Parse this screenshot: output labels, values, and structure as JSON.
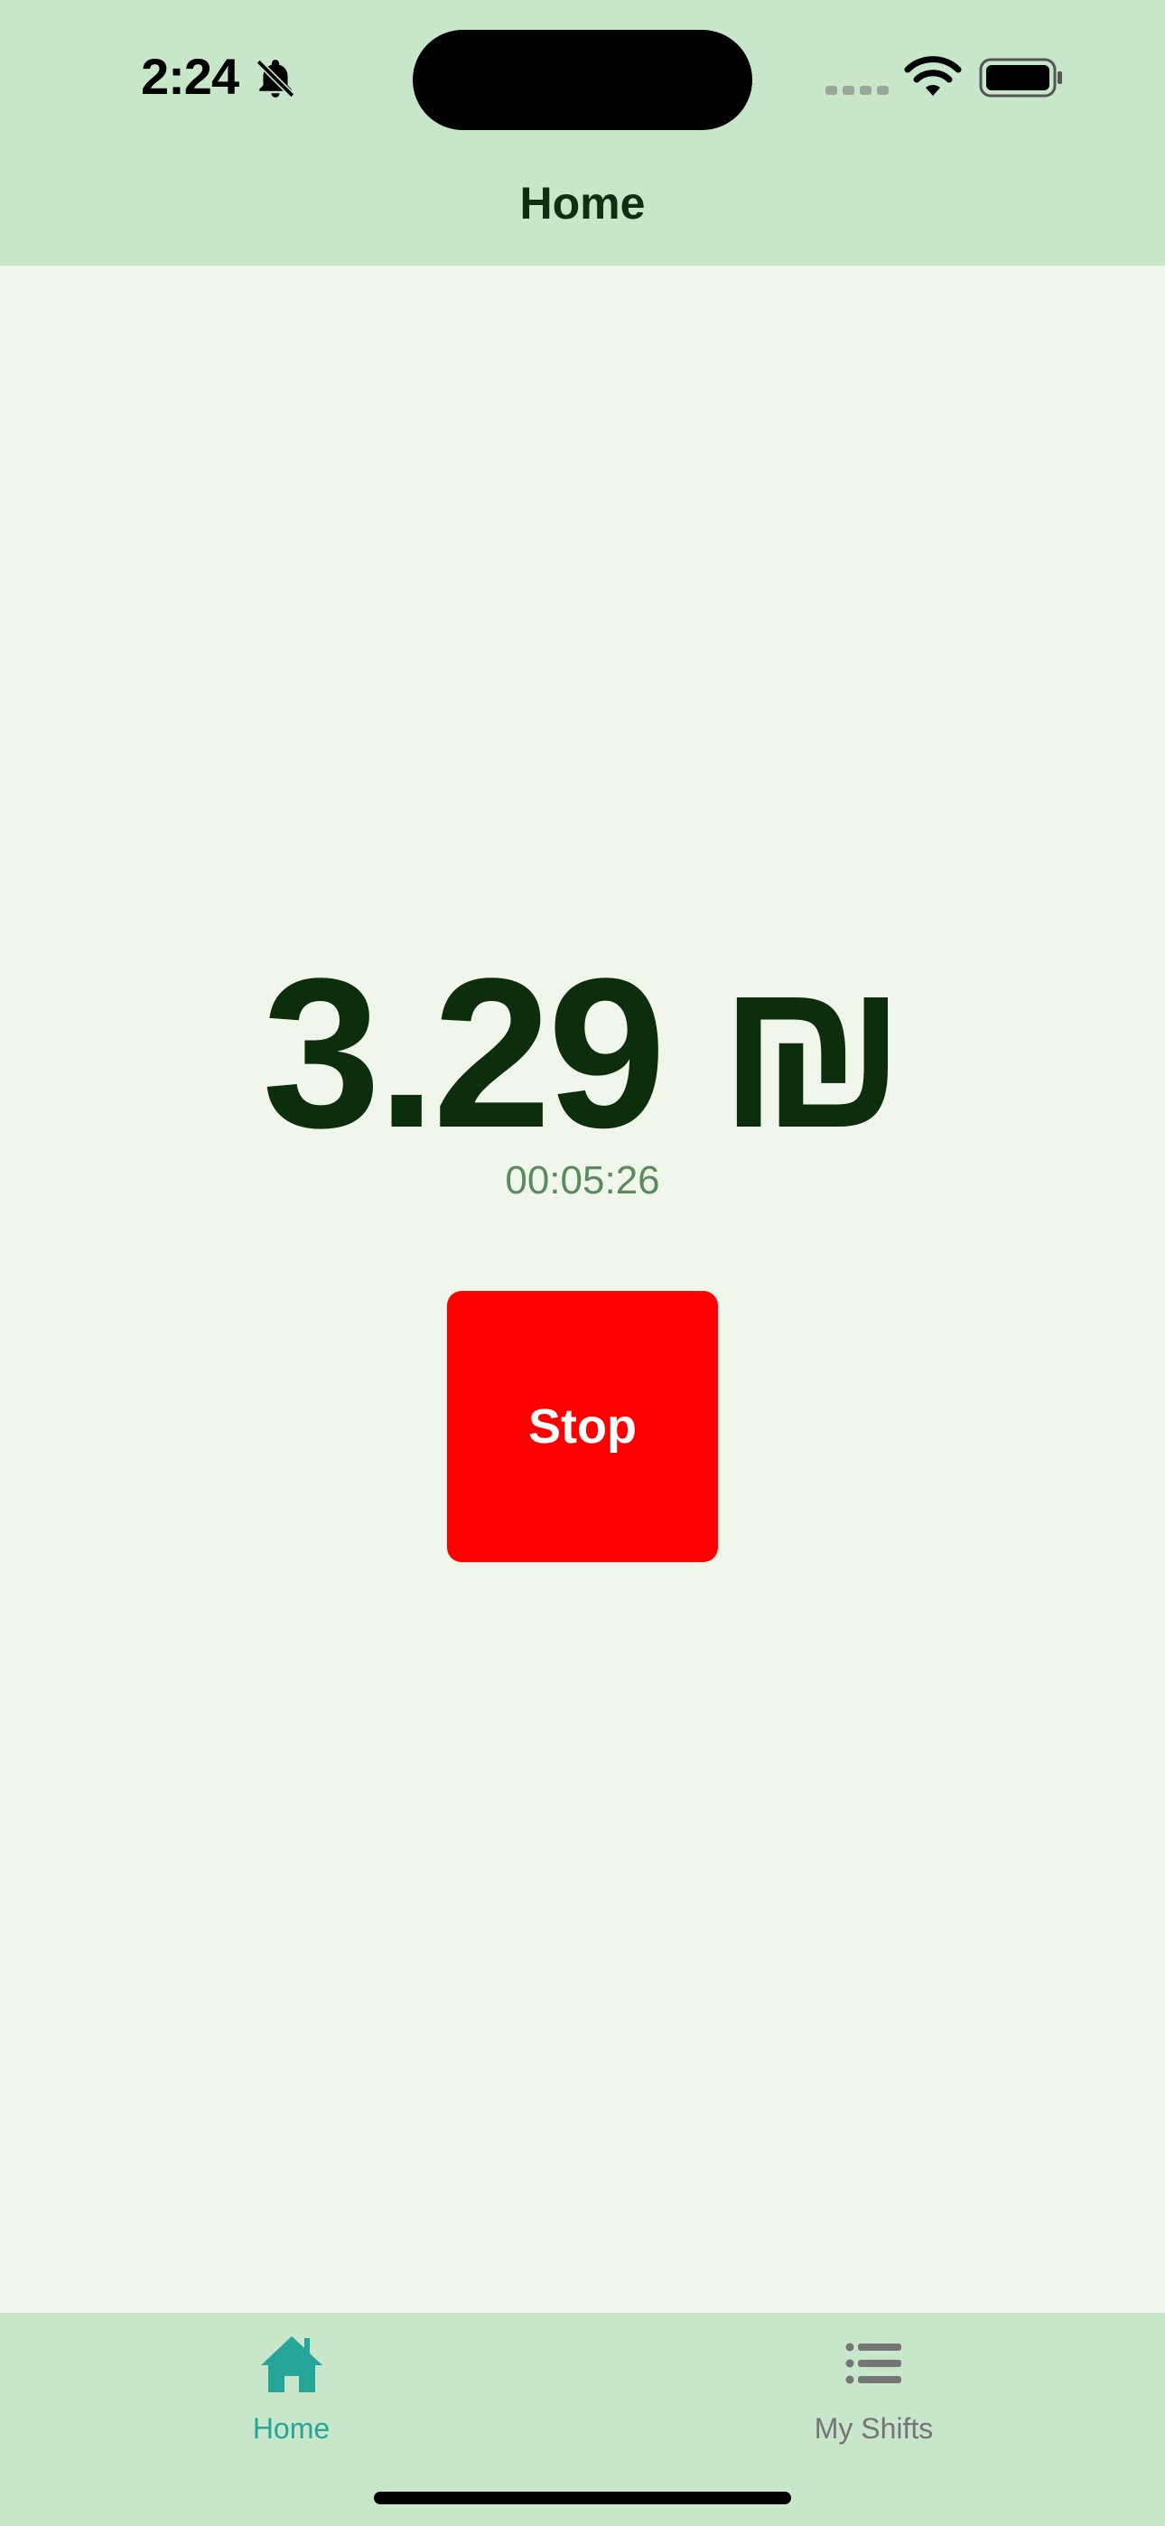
{
  "status_bar": {
    "time": "2:24"
  },
  "header": {
    "title": "Home"
  },
  "earnings": {
    "amount": "3.29 ₪",
    "elapsed": "00:05:26"
  },
  "actions": {
    "stop_label": "Stop"
  },
  "tabbar": {
    "tabs": [
      {
        "label": "Home",
        "icon": "home-icon",
        "active": true
      },
      {
        "label": "My Shifts",
        "icon": "list-icon",
        "active": false
      }
    ]
  },
  "colors": {
    "header_bg": "#c8e6c9",
    "page_bg": "#f1f6ea",
    "stop_button": "#ff0000",
    "active_tab": "#26a69a",
    "inactive_tab": "#757575"
  }
}
